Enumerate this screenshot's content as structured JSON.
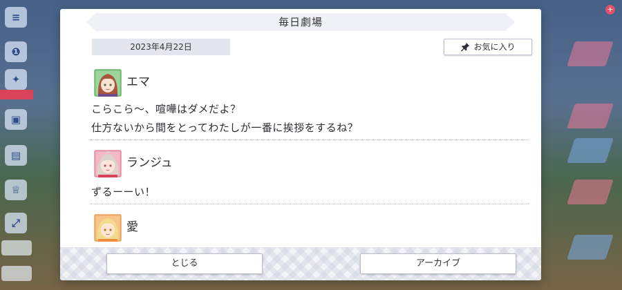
{
  "dialog": {
    "title": "毎日劇場",
    "date": "2023年4月22日",
    "favorite_label": "お気に入り",
    "close_label": "とじる",
    "archive_label": "アーカイブ"
  },
  "entries": [
    {
      "speaker": "エマ",
      "lines": [
        "こらこら〜、喧嘩はダメだよ？",
        "仕方ないから間をとってわたしが一番に挨拶をするね？"
      ]
    },
    {
      "speaker": "ランジュ",
      "lines": [
        "ずるーーい！"
      ]
    },
    {
      "speaker": "愛",
      "lines": []
    }
  ],
  "scroll": {
    "thumb_fraction": 0.35,
    "position_fraction": 0.6
  },
  "colors": {
    "accent_pink": "#ef7f92",
    "emma_avatar_bg": "#9cd49a",
    "lanzhu_avatar_bg": "#f4b9c6",
    "ai_avatar_bg": "#f7c58a"
  },
  "icons": {
    "favorite": "pin-icon",
    "menu": "menu-icon"
  }
}
